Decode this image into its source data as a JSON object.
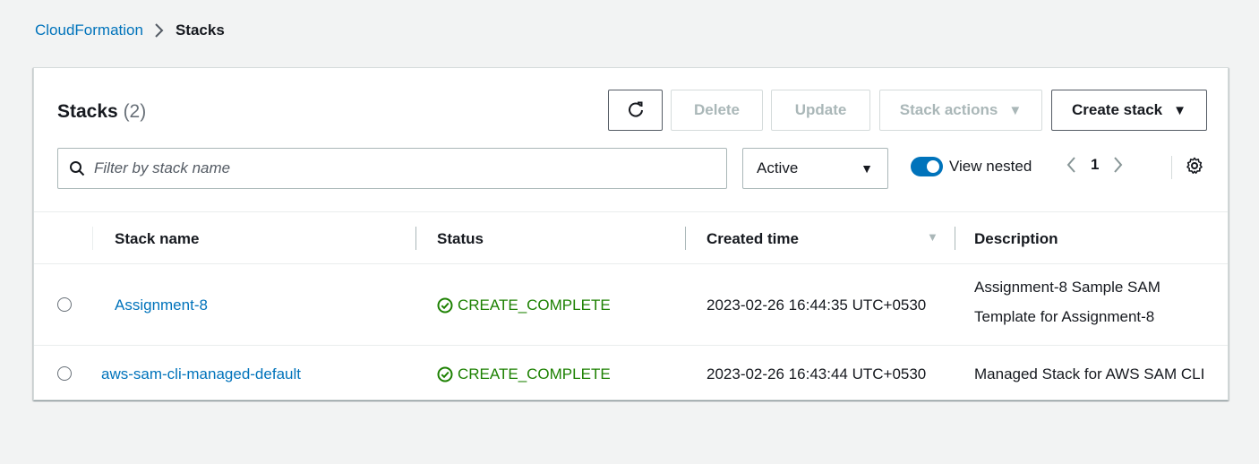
{
  "breadcrumb": {
    "root": "CloudFormation",
    "current": "Stacks"
  },
  "panel": {
    "title": "Stacks",
    "count": "(2)"
  },
  "toolbar": {
    "refresh_icon": "refresh-icon",
    "delete_label": "Delete",
    "update_label": "Update",
    "stack_actions_label": "Stack actions",
    "create_stack_label": "Create stack",
    "caret": "▼"
  },
  "filter": {
    "placeholder": "Filter by stack name",
    "value": ""
  },
  "status_filter": {
    "selected": "Active",
    "caret": "▼"
  },
  "view_nested": {
    "label": "View nested",
    "enabled": true
  },
  "pagination": {
    "current_page": "1"
  },
  "table": {
    "columns": [
      "Stack name",
      "Status",
      "Created time",
      "Description"
    ],
    "sort_caret": "▼",
    "rows": [
      {
        "name": "Assignment-8",
        "status": "CREATE_COMPLETE",
        "created": "2023-02-26 16:44:35 UTC+0530",
        "description_line1": "Assignment-8 Sample SAM",
        "description_line2": "Template for Assignment-8"
      },
      {
        "name": "aws-sam-cli-managed-default",
        "status": "CREATE_COMPLETE",
        "created": "2023-02-26 16:43:44 UTC+0530",
        "description_line1": "Managed Stack for AWS SAM CLI",
        "description_line2": ""
      }
    ]
  },
  "colors": {
    "link": "#0073bb",
    "success": "#1d8102",
    "disabled": "#aab7b8",
    "background": "#f2f3f3"
  }
}
